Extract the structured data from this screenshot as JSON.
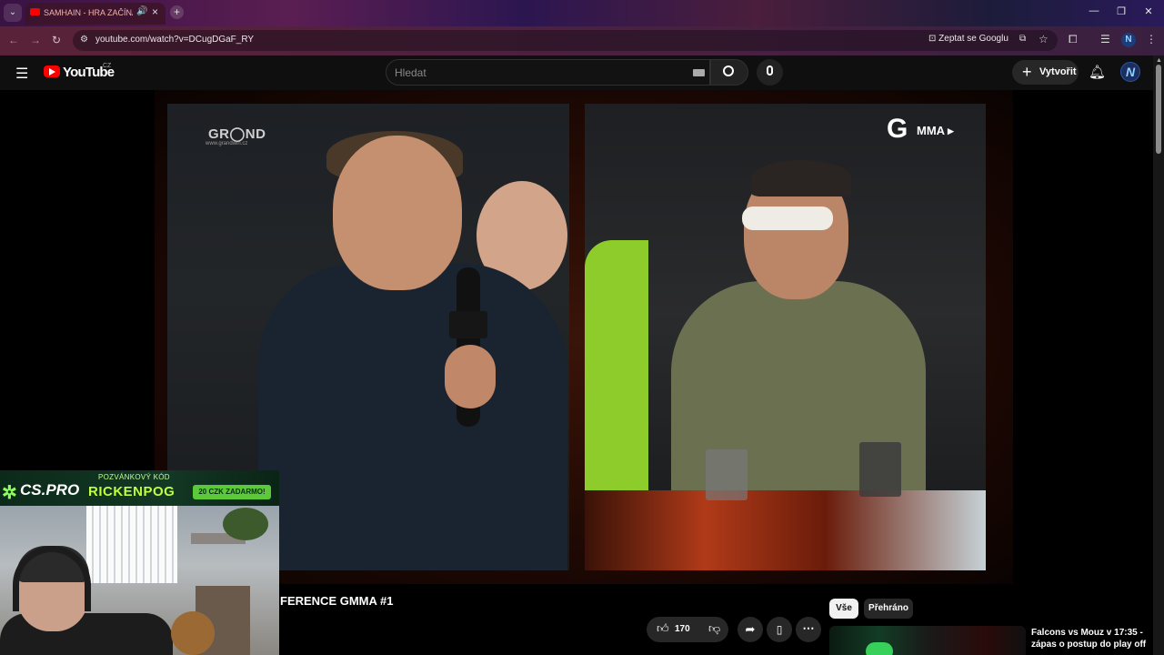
{
  "browser": {
    "tab_title": "SAMHAIN - HRA ZAČÍNÁ | RICKENPOG",
    "tab_audio": "🔊",
    "url": "youtube.com/watch?v=DCugDGaF_RY",
    "ask_google_label": "Zeptat se Googlu",
    "new_tab": "+",
    "window_controls": {
      "minimize": "—",
      "maximize": "❐",
      "close": "✕"
    }
  },
  "youtube": {
    "logo_text": "YouTube",
    "country_code": "CZ",
    "search_placeholder": "Hledat",
    "create_label": "Vytvořit",
    "create_plus": "+"
  },
  "video": {
    "overlay_left_logo": "GR◯ND",
    "overlay_left_url": "www.grandwin.cz",
    "overlay_right_g": "G",
    "overlay_right_label": "MMA ▸",
    "title": "FERENCE GMMA #1"
  },
  "promo": {
    "brand": "CS.PRO",
    "code_label": "POZVÁNKOVÝ KÓD",
    "code": "RICKENPOG",
    "badge": "20 CZK ZADARMO!"
  },
  "actions": {
    "like_count": "170"
  },
  "chips": {
    "all": "Vše",
    "watched": "Přehráno"
  },
  "recommendation": {
    "title": "Falcons vs Mouz v 17:35 - zápas o postup do play off",
    "subtitle": ""
  }
}
